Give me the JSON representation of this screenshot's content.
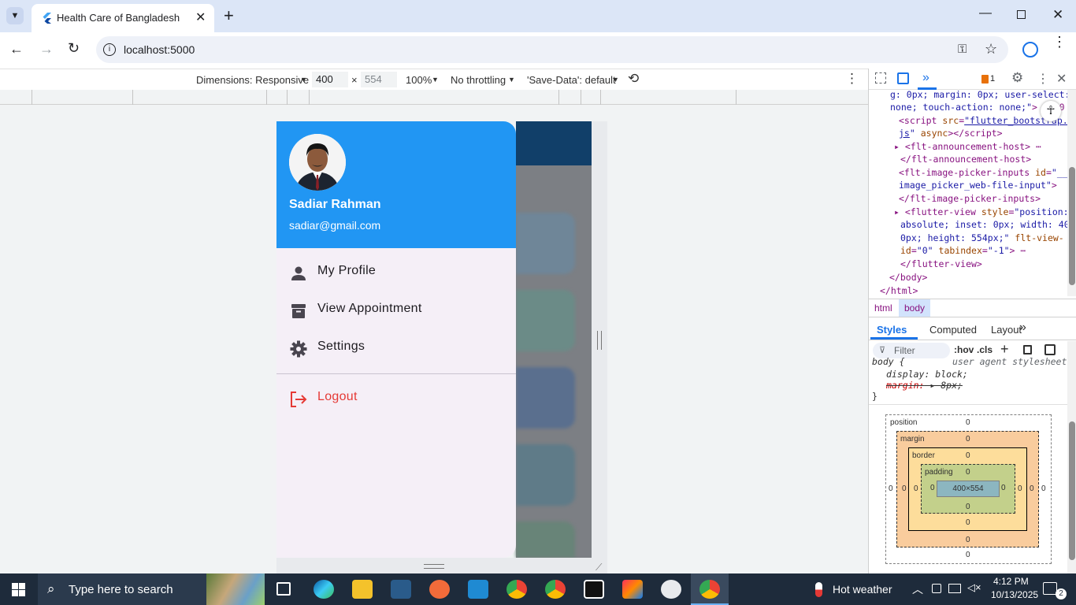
{
  "browser": {
    "tab_title": "Health Care of Bangladesh",
    "url": "localhost:5000"
  },
  "devtools_toolbar": {
    "dimensions_label": "Dimensions: Responsive",
    "width": "400",
    "height": "554",
    "zoom": "100%",
    "throttling": "No throttling",
    "save_data": "'Save-Data': default"
  },
  "drawer": {
    "user_name": "Sadiar Rahman",
    "user_email": "sadiar@gmail.com",
    "items": [
      {
        "label": "My Profile",
        "icon": "person-icon"
      },
      {
        "label": "View Appointment",
        "icon": "archive-icon"
      },
      {
        "label": "Settings",
        "icon": "gear-icon"
      }
    ],
    "logout_label": "Logout",
    "accent_color": "#2196f3",
    "logout_color": "#e53935"
  },
  "devpanel": {
    "issues_count": "1",
    "breadcrumbs": [
      "html",
      "body"
    ],
    "tabs": [
      "Styles",
      "Computed",
      "Layout"
    ],
    "filter_placeholder": "Filter",
    "hov": ":hov",
    "cls": ".cls",
    "style_rule": {
      "selector": "body {",
      "source": "user agent stylesheet",
      "prop1": "display: block;",
      "prop2": "margin:",
      "prop2_value": "8px;",
      "close": "}"
    },
    "box_model": {
      "position_label": "position",
      "margin_label": "margin",
      "border_label": "border",
      "padding_label": "padding",
      "content_size": "400×554",
      "zero": "0"
    }
  },
  "taskbar": {
    "search_placeholder": "Type here to search",
    "weather": "Hot weather",
    "time": "4:12 PM",
    "date": "10/13/2025",
    "notifications": "2"
  }
}
